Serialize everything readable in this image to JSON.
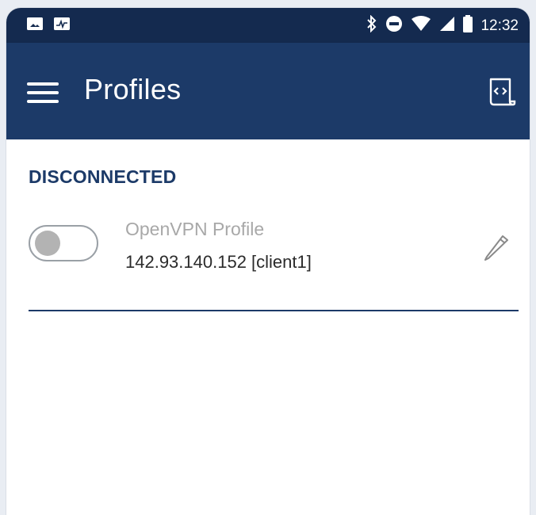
{
  "status_bar": {
    "time": "12:32",
    "left_icons": [
      "image-icon",
      "activity-icon"
    ],
    "right_icons": [
      "bluetooth-icon",
      "do-not-disturb-icon",
      "wifi-icon",
      "signal-icon",
      "battery-icon"
    ]
  },
  "app_bar": {
    "title": "Profiles",
    "menu_icon": "hamburger-menu-icon",
    "action_icon": "import-profile-icon"
  },
  "section": {
    "header": "DISCONNECTED"
  },
  "profile": {
    "name": "OpenVPN Profile",
    "detail": "142.93.140.152 [client1]",
    "toggle_on": false,
    "edit_icon": "pencil-icon"
  },
  "colors": {
    "status_bar": "#142a4f",
    "app_bar": "#1c3a68",
    "accent": "#1c3a68",
    "profile_name": "#a8a8a8"
  }
}
